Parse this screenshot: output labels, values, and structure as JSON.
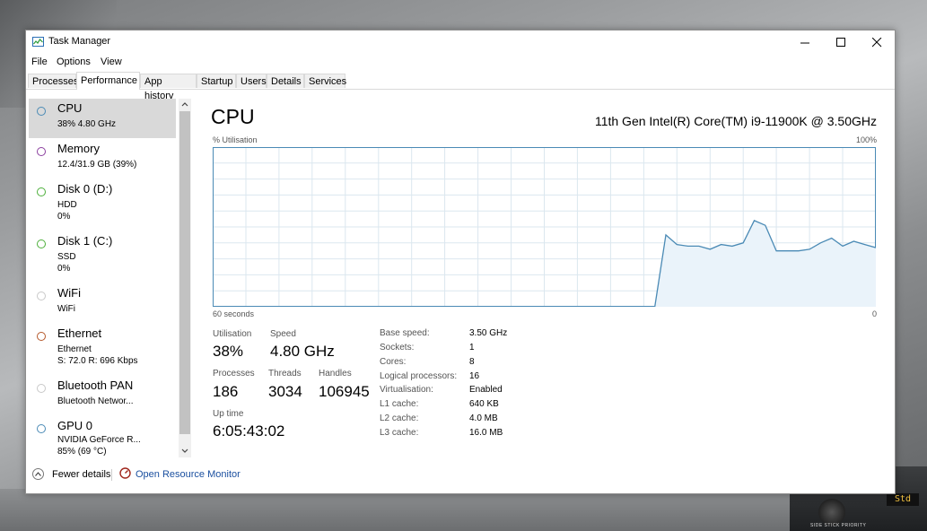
{
  "window": {
    "title": "Task Manager",
    "colors": {
      "graph_line": "#4a8ab5",
      "graph_fill": "#eaf3fa",
      "grid": "#dbe7ef",
      "link": "#1a4f9f"
    }
  },
  "menu": [
    "File",
    "Options",
    "View"
  ],
  "tabs": [
    {
      "label": "Processes",
      "active": false
    },
    {
      "label": "Performance",
      "active": true
    },
    {
      "label": "App history",
      "active": false
    },
    {
      "label": "Startup",
      "active": false
    },
    {
      "label": "Users",
      "active": false
    },
    {
      "label": "Details",
      "active": false
    },
    {
      "label": "Services",
      "active": false
    }
  ],
  "sidebar": [
    {
      "name": "CPU",
      "sub": [
        "38%  4.80 GHz"
      ],
      "color": "#4a8ab5",
      "selected": true
    },
    {
      "name": "Memory",
      "sub": [
        "12.4/31.9 GB (39%)"
      ],
      "color": "#8b3f9f",
      "selected": false
    },
    {
      "name": "Disk 0 (D:)",
      "sub": [
        "HDD",
        "0%"
      ],
      "color": "#4caf3a",
      "selected": false
    },
    {
      "name": "Disk 1 (C:)",
      "sub": [
        "SSD",
        "0%"
      ],
      "color": "#4caf3a",
      "selected": false
    },
    {
      "name": "WiFi",
      "sub": [
        "WiFi"
      ],
      "color": "#c8c8c8",
      "selected": false
    },
    {
      "name": "Ethernet",
      "sub": [
        "Ethernet",
        "S: 72.0  R: 696 Kbps"
      ],
      "color": "#b5582a",
      "selected": false
    },
    {
      "name": "Bluetooth PAN",
      "sub": [
        "Bluetooth Networ..."
      ],
      "color": "#c8c8c8",
      "selected": false
    },
    {
      "name": "GPU 0",
      "sub": [
        "NVIDIA GeForce R...",
        "85%  (69 °C)"
      ],
      "color": "#4a8ab5",
      "selected": false
    }
  ],
  "main": {
    "title": "CPU",
    "model": "11th Gen Intel(R) Core(TM) i9-11900K @ 3.50GHz",
    "util_label": "% Utilisation",
    "max_label": "100%",
    "time_left": "60 seconds",
    "time_right": "0",
    "graph": {
      "type": "area",
      "ylim": [
        0,
        100
      ],
      "x_seconds_ago": [
        60,
        59,
        58,
        57,
        56,
        55,
        54,
        53,
        52,
        51,
        50,
        49,
        48,
        47,
        46,
        45,
        44,
        43,
        42,
        41,
        40,
        39,
        38,
        37,
        36,
        35,
        34,
        33,
        32,
        31,
        30,
        29,
        28,
        27,
        26,
        25,
        24,
        23,
        22,
        21,
        20,
        19,
        18,
        17,
        16,
        15,
        14,
        13,
        12,
        11,
        10,
        9,
        8,
        7,
        6,
        5,
        4,
        3,
        2,
        1,
        0
      ],
      "values": [
        0,
        0,
        0,
        0,
        0,
        0,
        0,
        0,
        0,
        0,
        0,
        0,
        0,
        0,
        0,
        0,
        0,
        0,
        0,
        0,
        0,
        0,
        0,
        0,
        0,
        0,
        0,
        0,
        0,
        0,
        0,
        0,
        0,
        0,
        0,
        0,
        0,
        0,
        0,
        0,
        0,
        45,
        39,
        38,
        38,
        36,
        39,
        38,
        40,
        54,
        51,
        35,
        35,
        35,
        36,
        40,
        43,
        38,
        41,
        39,
        37
      ]
    },
    "stats": [
      {
        "label": "Utilisation",
        "value": "38%"
      },
      {
        "label": "Speed",
        "value": "4.80 GHz"
      },
      {
        "label": "Processes",
        "value": "186"
      },
      {
        "label": "Threads",
        "value": "3034"
      },
      {
        "label": "Handles",
        "value": "106945"
      },
      {
        "label": "Up time",
        "value": "6:05:43:02"
      }
    ],
    "specs": [
      {
        "key": "Base speed:",
        "value": "3.50 GHz"
      },
      {
        "key": "Sockets:",
        "value": "1"
      },
      {
        "key": "Cores:",
        "value": "8"
      },
      {
        "key": "Logical processors:",
        "value": "16"
      },
      {
        "key": "Virtualisation:",
        "value": "Enabled"
      },
      {
        "key": "L1 cache:",
        "value": "640 KB"
      },
      {
        "key": "L2 cache:",
        "value": "4.0 MB"
      },
      {
        "key": "L3 cache:",
        "value": "16.0 MB"
      }
    ]
  },
  "footer": {
    "fewer_details": "Fewer details",
    "open_monitor": "Open Resource Monitor"
  },
  "background": {
    "panel_text": "Std",
    "stick_label": "SIDE STICK PRIORITY"
  }
}
